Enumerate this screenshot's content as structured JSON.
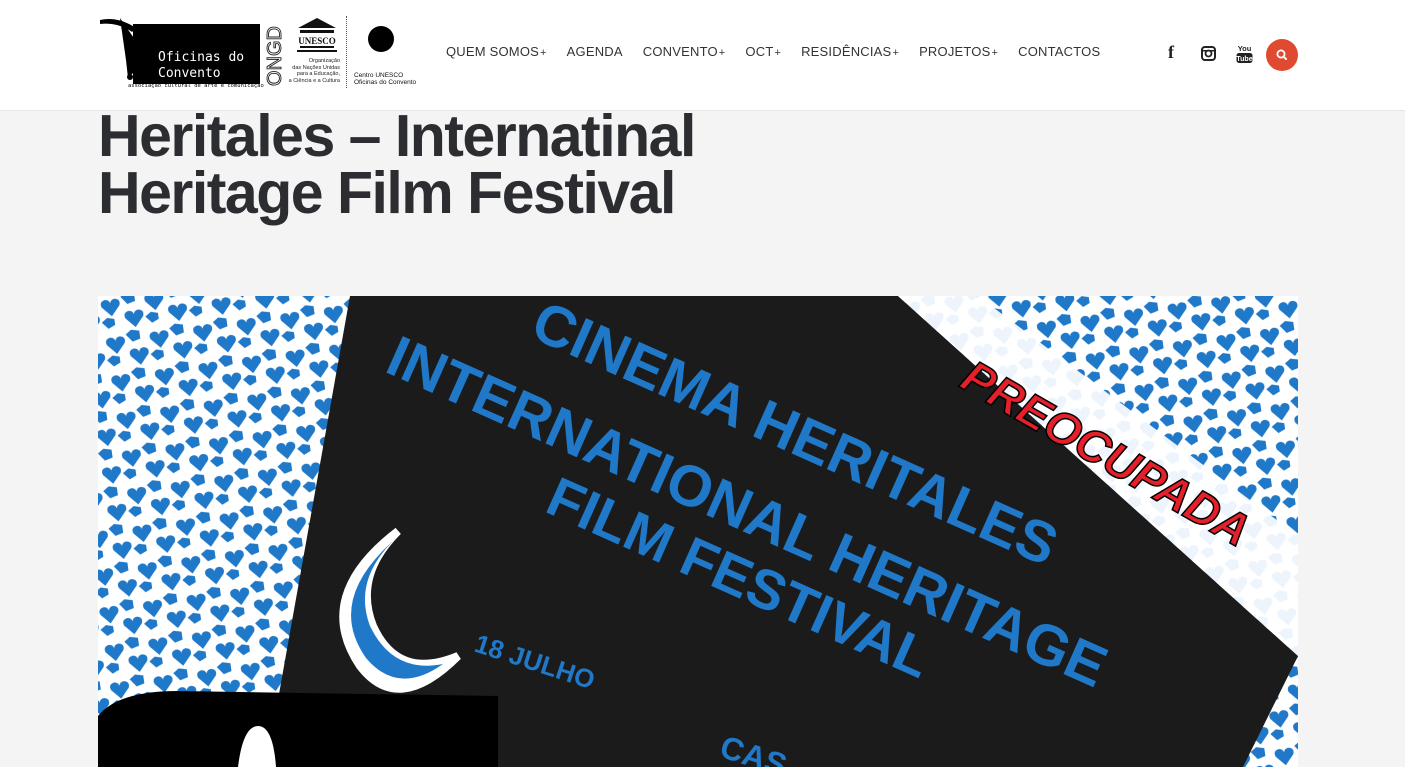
{
  "header": {
    "logo": {
      "name_line1": "Oficinas do",
      "name_line2": "Convento",
      "tagline": "associação cultural de arte e comunicação",
      "ongd": "ONGD",
      "unesco_word": "UNESCO",
      "unesco_lines": [
        "Organização",
        "das Nações Unidas",
        "para a Educação,",
        "a Ciência e a Cultura"
      ],
      "centro_lines": [
        "Centro UNESCO",
        "Oficinas do Convento"
      ]
    },
    "nav": [
      {
        "label": "QUEM SOMOS",
        "has_submenu": true
      },
      {
        "label": "AGENDA",
        "has_submenu": false
      },
      {
        "label": "CONVENTO",
        "has_submenu": true
      },
      {
        "label": "OCT",
        "has_submenu": true
      },
      {
        "label": "RESIDÊNCIAS",
        "has_submenu": true
      },
      {
        "label": "PROJETOS",
        "has_submenu": true
      },
      {
        "label": "CONTACTOS",
        "has_submenu": false
      }
    ],
    "plus_glyph": "+",
    "social": [
      {
        "icon": "facebook-icon",
        "glyph": "f"
      },
      {
        "icon": "instagram-icon",
        "glyph": ""
      },
      {
        "icon": "youtube-icon",
        "glyph": "You Tube"
      }
    ],
    "search_icon": "search-icon",
    "accent_color": "#e04a31"
  },
  "page": {
    "title_line1": "Heritales – Internatinal",
    "title_line2": "Heritage Film Festival"
  },
  "poster": {
    "line1": "CINEMA HERITALES",
    "line2": "INTERNATIONAL HERITAGE",
    "line3": "FILM FESTIVAL",
    "date": "18 JULHO",
    "stamp": "PREOCUPADA",
    "cut_text": "CAS",
    "blue": "#1f78c8",
    "red": "#e4202a"
  }
}
